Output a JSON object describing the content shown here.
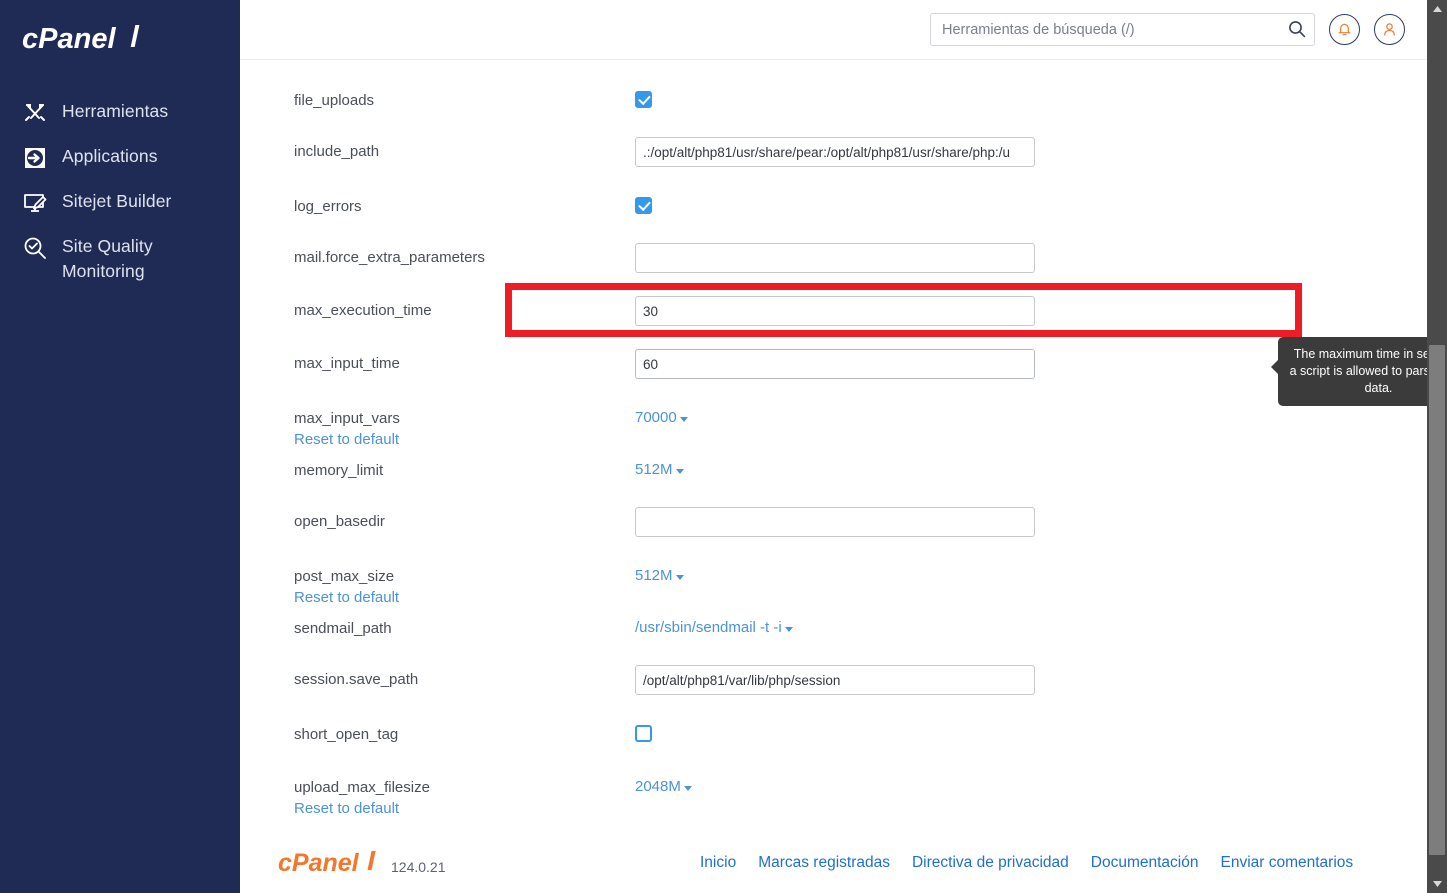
{
  "sidebar": {
    "logo_text": "cPanel",
    "items": [
      {
        "label": "Herramientas",
        "icon": "tools-icon"
      },
      {
        "label": "Applications",
        "icon": "applications-icon"
      },
      {
        "label": "Sitejet Builder",
        "icon": "sitejet-builder-icon"
      },
      {
        "label": "Site Quality Monitoring",
        "icon": "site-quality-monitoring-icon"
      }
    ]
  },
  "topbar": {
    "search_placeholder": "Herramientas de búsqueda (/)",
    "search_value": "",
    "search_icon": "search-icon",
    "notifications_icon": "bell-icon",
    "user_icon": "user-icon"
  },
  "form": {
    "reset_label": "Reset to default",
    "rows": [
      {
        "name": "file_uploads",
        "type": "checkbox",
        "checked": true,
        "reset": false
      },
      {
        "name": "include_path",
        "type": "text",
        "value": ".:/opt/alt/php81/usr/share/pear:/opt/alt/php81/usr/share/php:/u",
        "reset": false
      },
      {
        "name": "log_errors",
        "type": "checkbox",
        "checked": true,
        "reset": false
      },
      {
        "name": "mail.force_extra_parameters",
        "type": "text",
        "value": "",
        "reset": false
      },
      {
        "name": "max_execution_time",
        "type": "text",
        "value": "30",
        "reset": false,
        "highlighted": true
      },
      {
        "name": "max_input_time",
        "type": "text",
        "value": "60",
        "reset": false,
        "focused": true
      },
      {
        "name": "max_input_vars",
        "type": "dropdown",
        "value": "70000",
        "reset": true
      },
      {
        "name": "memory_limit",
        "type": "dropdown",
        "value": "512M",
        "reset": false
      },
      {
        "name": "open_basedir",
        "type": "text",
        "value": "",
        "reset": false
      },
      {
        "name": "post_max_size",
        "type": "dropdown",
        "value": "512M",
        "reset": true
      },
      {
        "name": "sendmail_path",
        "type": "dropdown",
        "value": "/usr/sbin/sendmail -t -i",
        "reset": false
      },
      {
        "name": "session.save_path",
        "type": "text",
        "value": "/opt/alt/php81/var/lib/php/session",
        "reset": false
      },
      {
        "name": "short_open_tag",
        "type": "checkbox",
        "checked": false,
        "reset": false
      },
      {
        "name": "upload_max_filesize",
        "type": "dropdown",
        "value": "2048M",
        "reset": true
      }
    ]
  },
  "tooltip": {
    "text": "The maximum time in seconds a script is allowed to parse input data."
  },
  "footer": {
    "logo_text": "cPanel",
    "version": "124.0.21",
    "links": [
      "Inicio",
      "Marcas registradas",
      "Directiva de privacidad",
      "Documentación",
      "Enviar comentarios"
    ]
  },
  "colors": {
    "sidebar_bg": "#1f2a55",
    "accent_blue": "#4a93d9",
    "link_blue": "#1f6fd0",
    "highlight_red": "#ee1c25",
    "logo_orange": "#f5762b",
    "tooltip_bg": "#3b3b3b"
  }
}
